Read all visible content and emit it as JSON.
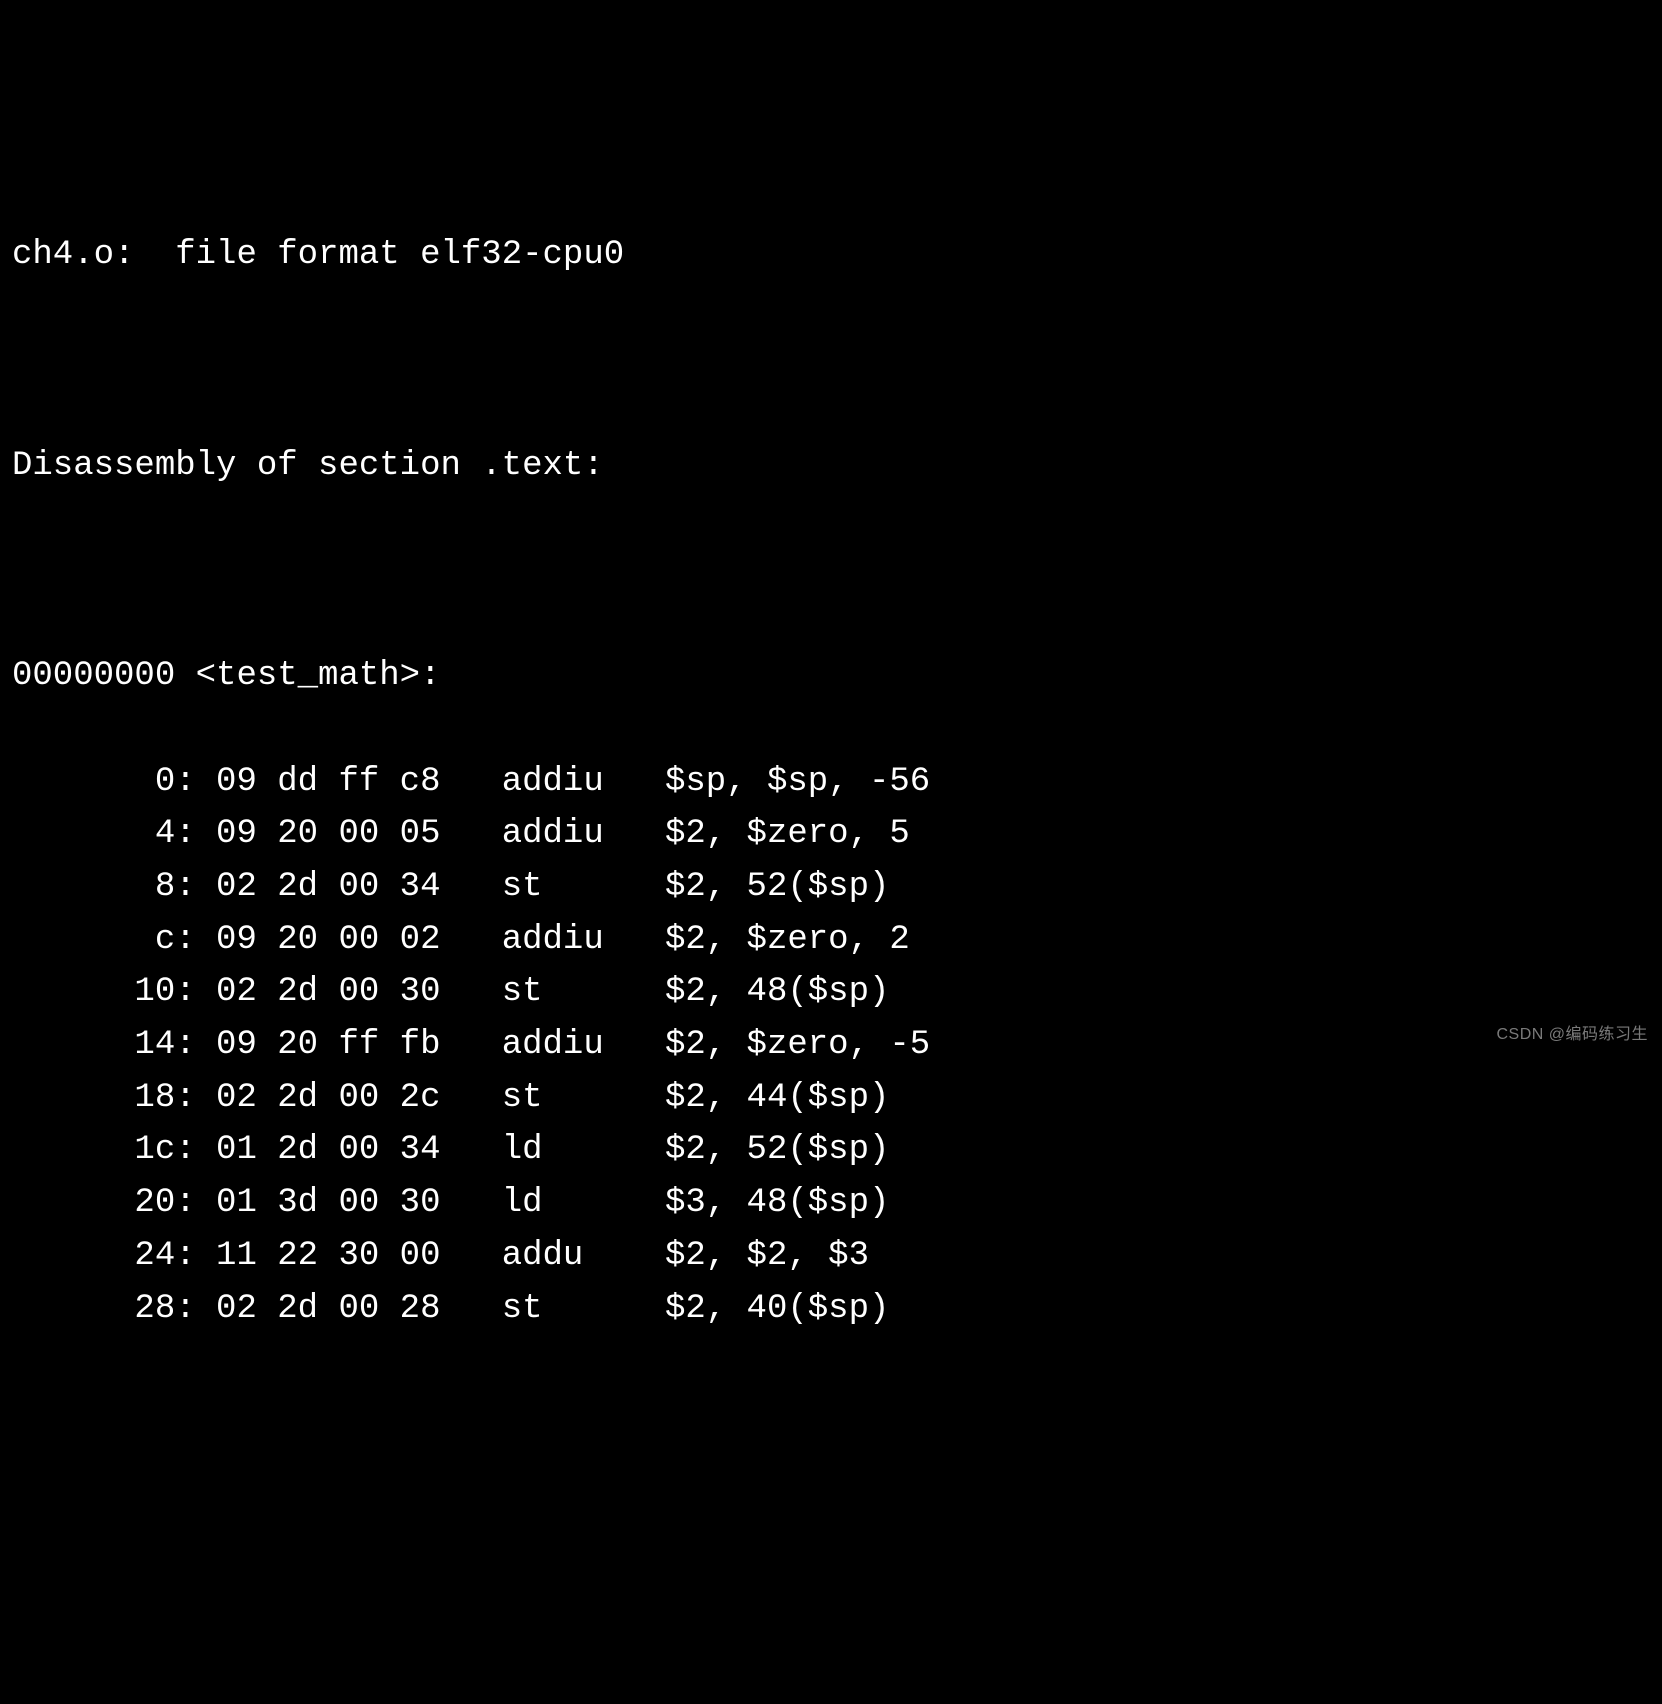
{
  "header": {
    "filename": "ch4.o",
    "file_format_label": "file format",
    "file_format": "elf32-cpu0"
  },
  "section_header": "Disassembly of section .text:",
  "symbol": {
    "address": "00000000",
    "name": "<test_math>:"
  },
  "instructions": [
    {
      "offset": "0",
      "bytes": [
        "09",
        "dd",
        "ff",
        "c8"
      ],
      "mnemonic": "addiu",
      "operands": "$sp, $sp, -56"
    },
    {
      "offset": "4",
      "bytes": [
        "09",
        "20",
        "00",
        "05"
      ],
      "mnemonic": "addiu",
      "operands": "$2, $zero, 5"
    },
    {
      "offset": "8",
      "bytes": [
        "02",
        "2d",
        "00",
        "34"
      ],
      "mnemonic": "st",
      "operands": "$2, 52($sp)"
    },
    {
      "offset": "c",
      "bytes": [
        "09",
        "20",
        "00",
        "02"
      ],
      "mnemonic": "addiu",
      "operands": "$2, $zero, 2"
    },
    {
      "offset": "10",
      "bytes": [
        "02",
        "2d",
        "00",
        "30"
      ],
      "mnemonic": "st",
      "operands": "$2, 48($sp)"
    },
    {
      "offset": "14",
      "bytes": [
        "09",
        "20",
        "ff",
        "fb"
      ],
      "mnemonic": "addiu",
      "operands": "$2, $zero, -5"
    },
    {
      "offset": "18",
      "bytes": [
        "02",
        "2d",
        "00",
        "2c"
      ],
      "mnemonic": "st",
      "operands": "$2, 44($sp)"
    },
    {
      "offset": "1c",
      "bytes": [
        "01",
        "2d",
        "00",
        "34"
      ],
      "mnemonic": "ld",
      "operands": "$2, 52($sp)"
    },
    {
      "offset": "20",
      "bytes": [
        "01",
        "3d",
        "00",
        "30"
      ],
      "mnemonic": "ld",
      "operands": "$3, 48($sp)"
    },
    {
      "offset": "24",
      "bytes": [
        "11",
        "22",
        "30",
        "00"
      ],
      "mnemonic": "addu",
      "operands": "$2, $2, $3"
    },
    {
      "offset": "28",
      "bytes": [
        "02",
        "2d",
        "00",
        "28"
      ],
      "mnemonic": "st",
      "operands": "$2, 40($sp)"
    }
  ],
  "watermark": "CSDN @编码练习生"
}
